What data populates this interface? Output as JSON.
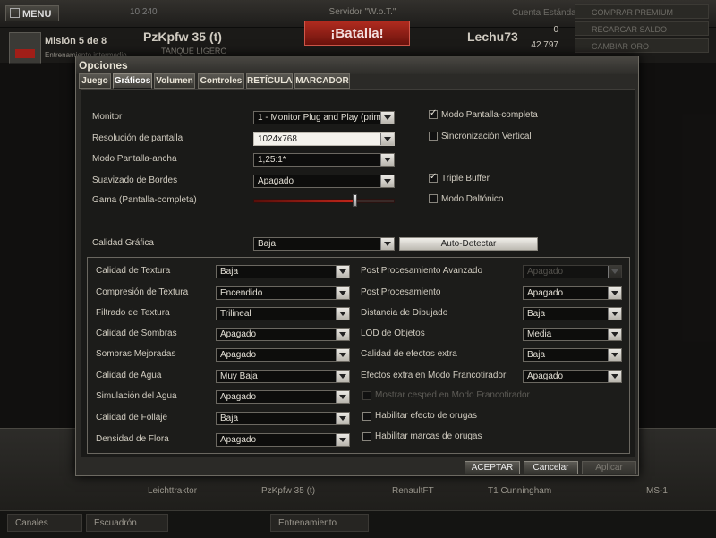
{
  "background": {
    "menu_label": "MENU",
    "gold_top": "10.240",
    "server": "Servidor \"W.o.T.\"",
    "battle_label": "¡Batalla!",
    "tank_name": "PzKpfw 35 (t)",
    "tank_type": "TANQUE LIGERO",
    "player": "Lechu73",
    "mission_title": "Misión 5 de 8",
    "mission_sub": "Entrenamiento intermedio",
    "account": "Cuenta Estándar",
    "gold": "0",
    "credits": "42.797",
    "side_buttons": [
      "COMPRAR PREMIUM",
      "RECARGAR SALDO",
      "CAMBIAR ORO"
    ],
    "carousel_tanks": [
      "Leichttraktor",
      "PzKpfw 35 (t)",
      "RenaultFT",
      "T1 Cunningham",
      "MS-1"
    ],
    "bottom_buttons": [
      "Canales",
      "Escuadrón",
      "Entrenamiento"
    ]
  },
  "dialog": {
    "title": "Opciones",
    "tabs": [
      {
        "label": "Juego",
        "active": false
      },
      {
        "label": "Gráficos",
        "active": true
      },
      {
        "label": "Volumen",
        "active": false
      },
      {
        "label": "Controles",
        "active": false
      },
      {
        "label": "RETÍCULA",
        "active": false
      },
      {
        "label": "MARCADOR",
        "active": false
      }
    ],
    "display": {
      "monitor_label": "Monitor",
      "monitor_value": "1 - Monitor Plug and Play (primario)",
      "resolution_label": "Resolución de pantalla",
      "resolution_value": "1024x768",
      "widescreen_label": "Modo Pantalla-ancha",
      "widescreen_value": "1,25:1*",
      "aa_label": "Suavizado de Bordes",
      "aa_value": "Apagado",
      "gamma_label": "Gama (Pantalla-completa)",
      "gamma_level": 0.72,
      "fullscreen_label": "Modo Pantalla-completa",
      "fullscreen_checked": true,
      "vsync_label": "Sincronización Vertical",
      "vsync_checked": false,
      "triple_label": "Triple Buffer",
      "triple_checked": true,
      "colorblind_label": "Modo Daltónico",
      "colorblind_checked": false,
      "quality_label": "Calidad Gráfica",
      "quality_value": "Baja",
      "autodetect_label": "Auto-Detectar"
    },
    "quality_left": [
      {
        "label": "Calidad de Textura",
        "value": "Baja"
      },
      {
        "label": "Compresión de Textura",
        "value": "Encendido"
      },
      {
        "label": "Filtrado de Textura",
        "value": "Trilineal"
      },
      {
        "label": "Calidad de Sombras",
        "value": "Apagado"
      },
      {
        "label": "Sombras Mejoradas",
        "value": "Apagado"
      },
      {
        "label": "Calidad de Agua",
        "value": "Muy Baja"
      },
      {
        "label": "Simulación del Agua",
        "value": "Apagado"
      },
      {
        "label": "Calidad de Follaje",
        "value": "Baja"
      },
      {
        "label": "Densidad de Flora",
        "value": "Apagado"
      }
    ],
    "quality_right": [
      {
        "label": "Post Procesamiento Avanzado",
        "value": "Apagado",
        "disabled": true
      },
      {
        "label": "Post Procesamiento",
        "value": "Apagado"
      },
      {
        "label": "Distancia de Dibujado",
        "value": "Baja"
      },
      {
        "label": "LOD de Objetos",
        "value": "Media"
      },
      {
        "label": "Calidad de efectos extra",
        "value": "Baja"
      },
      {
        "label": "Efectos extra en Modo Francotirador",
        "value": "Apagado"
      }
    ],
    "quality_checks": [
      {
        "label": "Mostrar cesped en Modo Francotirador",
        "checked": false,
        "disabled": true
      },
      {
        "label": "Habilitar efecto de orugas",
        "checked": false
      },
      {
        "label": "Habilitar marcas de orugas",
        "checked": false
      }
    ],
    "buttons": {
      "accept": "ACEPTAR",
      "cancel": "Cancelar",
      "apply": "Aplicar"
    }
  }
}
